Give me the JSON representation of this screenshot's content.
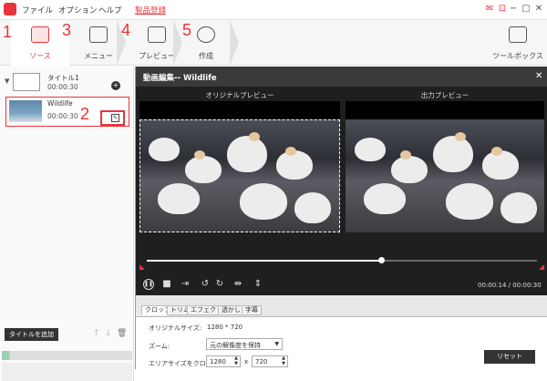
{
  "menubar": {
    "items": [
      "ファイル",
      "オプション",
      "ヘルプ",
      "製品登録"
    ],
    "accent": "#e8343a"
  },
  "toolbar": {
    "steps": [
      {
        "num": "1",
        "label": "ソース"
      },
      {
        "num": "3",
        "label": "メニュー"
      },
      {
        "num": "4",
        "label": "プレビュー"
      },
      {
        "num": "5",
        "label": "作成"
      }
    ],
    "toolbox_label": "ツールボックス"
  },
  "left": {
    "title_item": {
      "name": "タイトル1",
      "duration": "00:00:30"
    },
    "clip": {
      "name": "Wildlife",
      "duration": "00:00:30"
    },
    "annotation": "2",
    "add_title": "タイトルを追加"
  },
  "editor": {
    "title": "動画編集-- Wildlife",
    "original_label": "オリジナルプレビュー",
    "output_label": "出力プレビュー",
    "timecode": "00:00:14 / 00:00:30",
    "progress": 0.6,
    "tabs": [
      "クロップ",
      "トリム",
      "エフェクト",
      "透かし",
      "字幕"
    ],
    "original_size_label": "オリジナルサイズ:",
    "original_size": "1280 * 720",
    "zoom_label": "ズーム:",
    "zoom_value": "元の解像度を保持",
    "crop_label": "エリアサイズをクロップ:",
    "crop_w": "1280",
    "crop_sep": "x",
    "crop_h": "720",
    "reset_label": "リセット"
  }
}
